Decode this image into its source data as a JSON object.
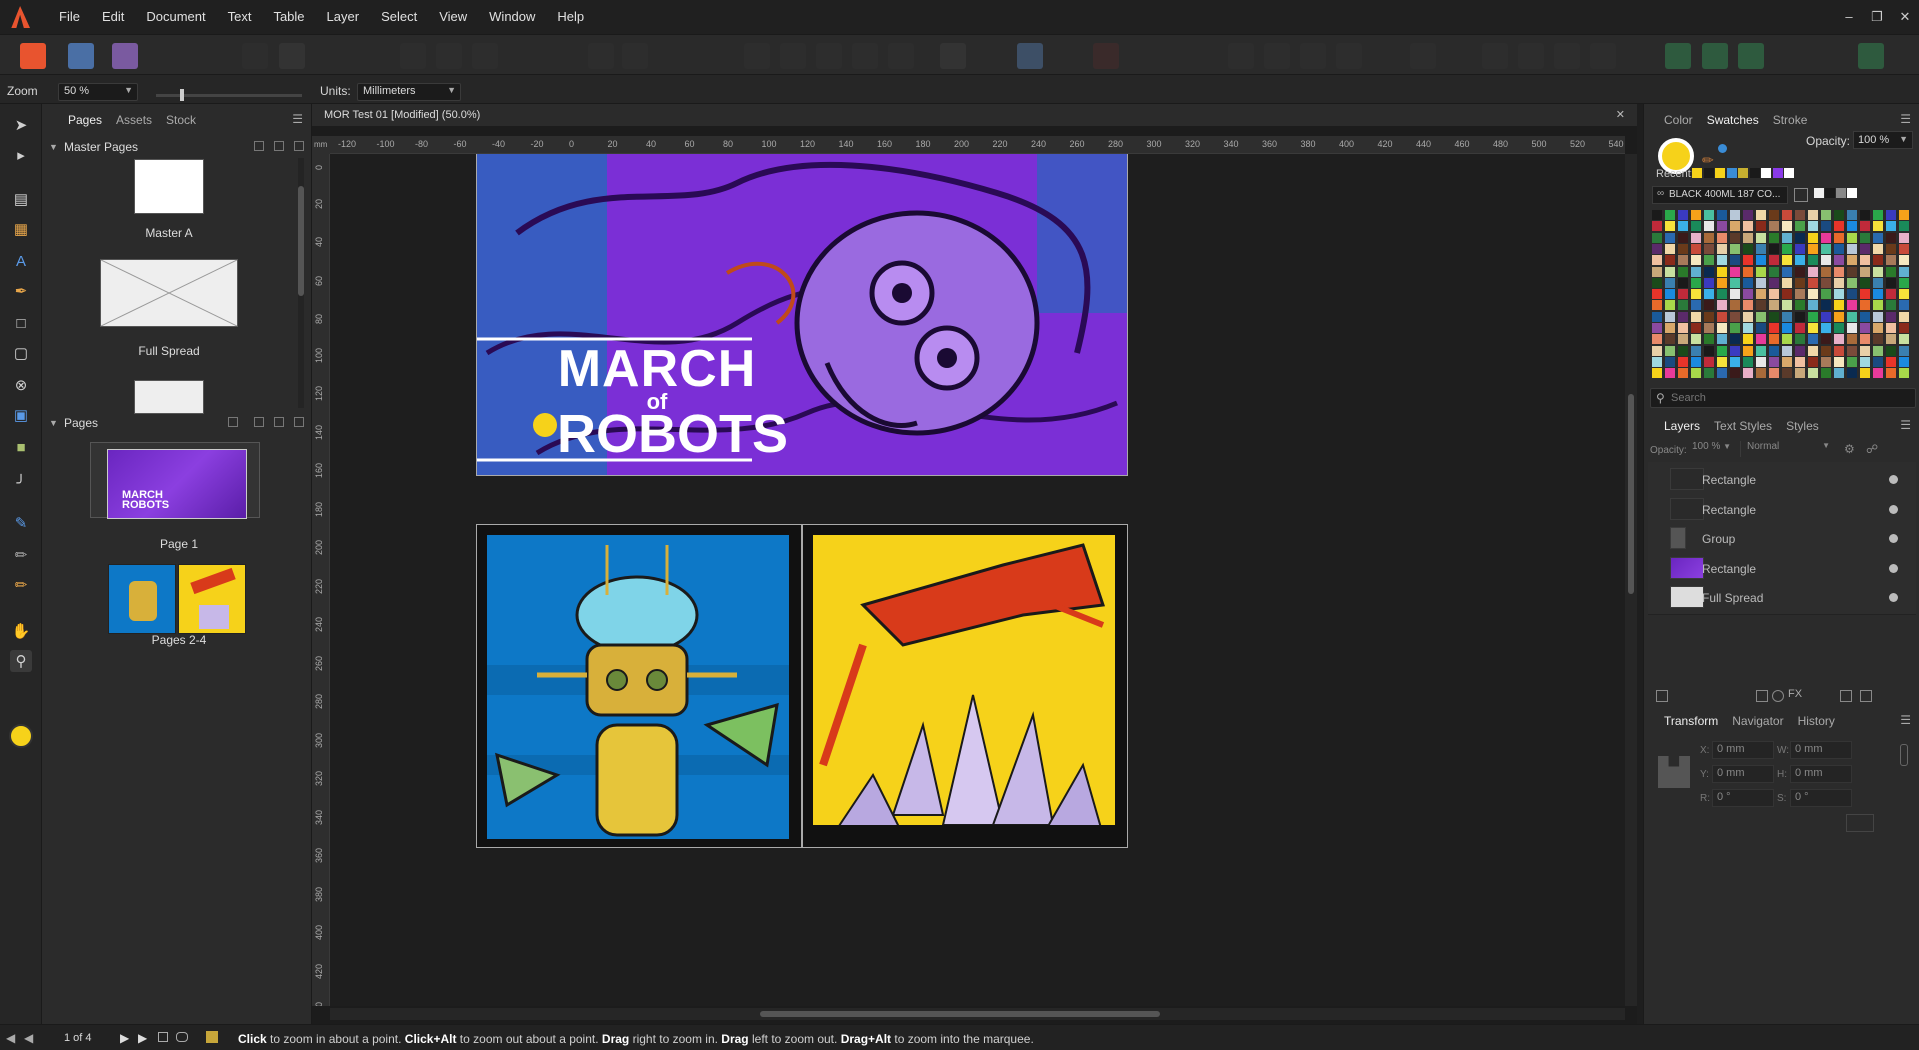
{
  "app": {
    "menu": [
      "File",
      "Edit",
      "Document",
      "Text",
      "Table",
      "Layer",
      "Select",
      "View",
      "Window",
      "Help"
    ],
    "brand_color": "#e8542f"
  },
  "context": {
    "zoom_label": "Zoom",
    "zoom_value": "50 %",
    "units_label": "Units:",
    "units_value": "Millimeters"
  },
  "left_panel": {
    "tabs": [
      "Pages",
      "Assets",
      "Stock"
    ],
    "master_pages_title": "Master Pages",
    "master_pages": [
      "Master A",
      "Full Spread"
    ],
    "pages_title": "Pages",
    "pages": [
      "Page 1",
      "Pages 2-4"
    ]
  },
  "document": {
    "title": "MOR Test 01 [Modified] (50.0%)",
    "ruler_h": [
      "-120",
      "-100",
      "-80",
      "-60",
      "-40",
      "-20",
      "0",
      "20",
      "40",
      "60",
      "80",
      "100",
      "120",
      "140",
      "160",
      "180",
      "200",
      "220",
      "240",
      "260",
      "280",
      "300",
      "320",
      "340",
      "360",
      "380",
      "400",
      "420",
      "440",
      "460",
      "480",
      "500",
      "520",
      "540"
    ],
    "ruler_v": [
      "0",
      "20",
      "40",
      "60",
      "80",
      "100",
      "120",
      "140",
      "160",
      "180",
      "200",
      "220",
      "240",
      "260",
      "280",
      "300",
      "320",
      "340",
      "360",
      "380",
      "400",
      "420",
      "440"
    ],
    "cover_title_line1": "MARCH",
    "cover_title_line2": "of",
    "cover_title_line3": "ROBOTS"
  },
  "right_panel": {
    "top_tabs": [
      "Color",
      "Swatches",
      "Stroke"
    ],
    "opacity_label": "Opacity:",
    "opacity_value": "100 %",
    "recent_label": "Recent:",
    "palette_name": "BLACK 400ML 187 CO...",
    "search_placeholder": "Search",
    "layer_tabs": [
      "Layers",
      "Text Styles",
      "Styles"
    ],
    "layer_opacity_label": "Opacity:",
    "layer_opacity_value": "100 %",
    "blend_mode": "Normal",
    "layers": [
      "Rectangle",
      "Rectangle",
      "Group",
      "Rectangle",
      "Full Spread"
    ],
    "bottom_tabs": [
      "Transform",
      "Navigator",
      "History"
    ],
    "transform": {
      "x_label": "X:",
      "x": "0 mm",
      "y_label": "Y:",
      "y": "0 mm",
      "w_label": "W:",
      "w": "0 mm",
      "h_label": "H:",
      "h": "0 mm",
      "r_label": "R:",
      "r": "0 °",
      "s_label": "S:",
      "s": "0 °"
    }
  },
  "status": {
    "page_indicator": "1 of 4",
    "hint_parts": [
      {
        "b": "Click",
        "t": " to zoom in about a point. "
      },
      {
        "b": "Click+Alt",
        "t": " to zoom out about a point. "
      },
      {
        "b": "Drag",
        "t": " right to zoom in. "
      },
      {
        "b": "Drag",
        "t": " left to zoom out. "
      },
      {
        "b": "Drag+Alt",
        "t": " to zoom into the marquee."
      }
    ]
  },
  "colors": {
    "purple": "#7b2fd6",
    "blue": "#0d78c7",
    "yellow": "#f6d21a",
    "accent": "#3a8cd6"
  }
}
